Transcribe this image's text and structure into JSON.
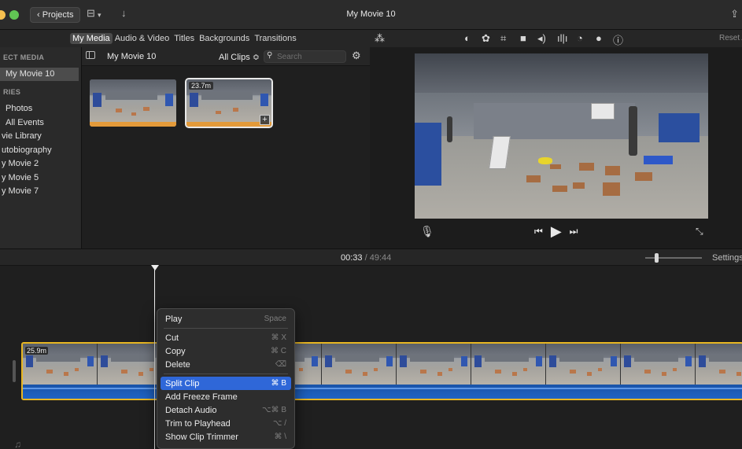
{
  "window": {
    "title": "My Movie 10",
    "projects_label": "Projects"
  },
  "browser_tabs": [
    "My Media",
    "Audio & Video",
    "Titles",
    "Backgrounds",
    "Transitions"
  ],
  "viewer_toolbar": {
    "reset_label": "Reset A"
  },
  "sidebar": {
    "heading_project": "ECT MEDIA",
    "selected_item": "My Movie 10",
    "heading_libraries": "RIES",
    "items": [
      "Photos",
      "All Events",
      "vie Library",
      "utobiography",
      "y Movie 2",
      "y Movie 5",
      "y Movie 7"
    ]
  },
  "browser": {
    "event_title": "My Movie 10",
    "filter_label": "All Clips ≎",
    "search_placeholder": "Search",
    "clips": [
      {
        "duration": ""
      },
      {
        "duration": "23.7m"
      }
    ]
  },
  "viewer": {},
  "timeline": {
    "current_time": "00:33",
    "separator": " / ",
    "total_time": "49:44",
    "settings_label": "Settings",
    "clip_duration": "25.9m"
  },
  "context_menu": [
    {
      "label": "Play",
      "shortcut": "Space"
    },
    {
      "separator": true
    },
    {
      "label": "Cut",
      "shortcut": "⌘ X"
    },
    {
      "label": "Copy",
      "shortcut": "⌘ C"
    },
    {
      "label": "Delete",
      "shortcut": "⌫"
    },
    {
      "separator": true
    },
    {
      "label": "Split Clip",
      "shortcut": "⌘ B",
      "highlighted": true
    },
    {
      "label": "Add Freeze Frame",
      "shortcut": ""
    },
    {
      "label": "Detach Audio",
      "shortcut": "⌥⌘ B"
    },
    {
      "label": "Trim to Playhead",
      "shortcut": "⌥ /"
    },
    {
      "label": "Show Clip Trimmer",
      "shortcut": "⌘ \\"
    }
  ],
  "colors": {
    "accent": "#2f67d8",
    "clip_border": "#e8b622",
    "audio": "#1f63c4"
  }
}
